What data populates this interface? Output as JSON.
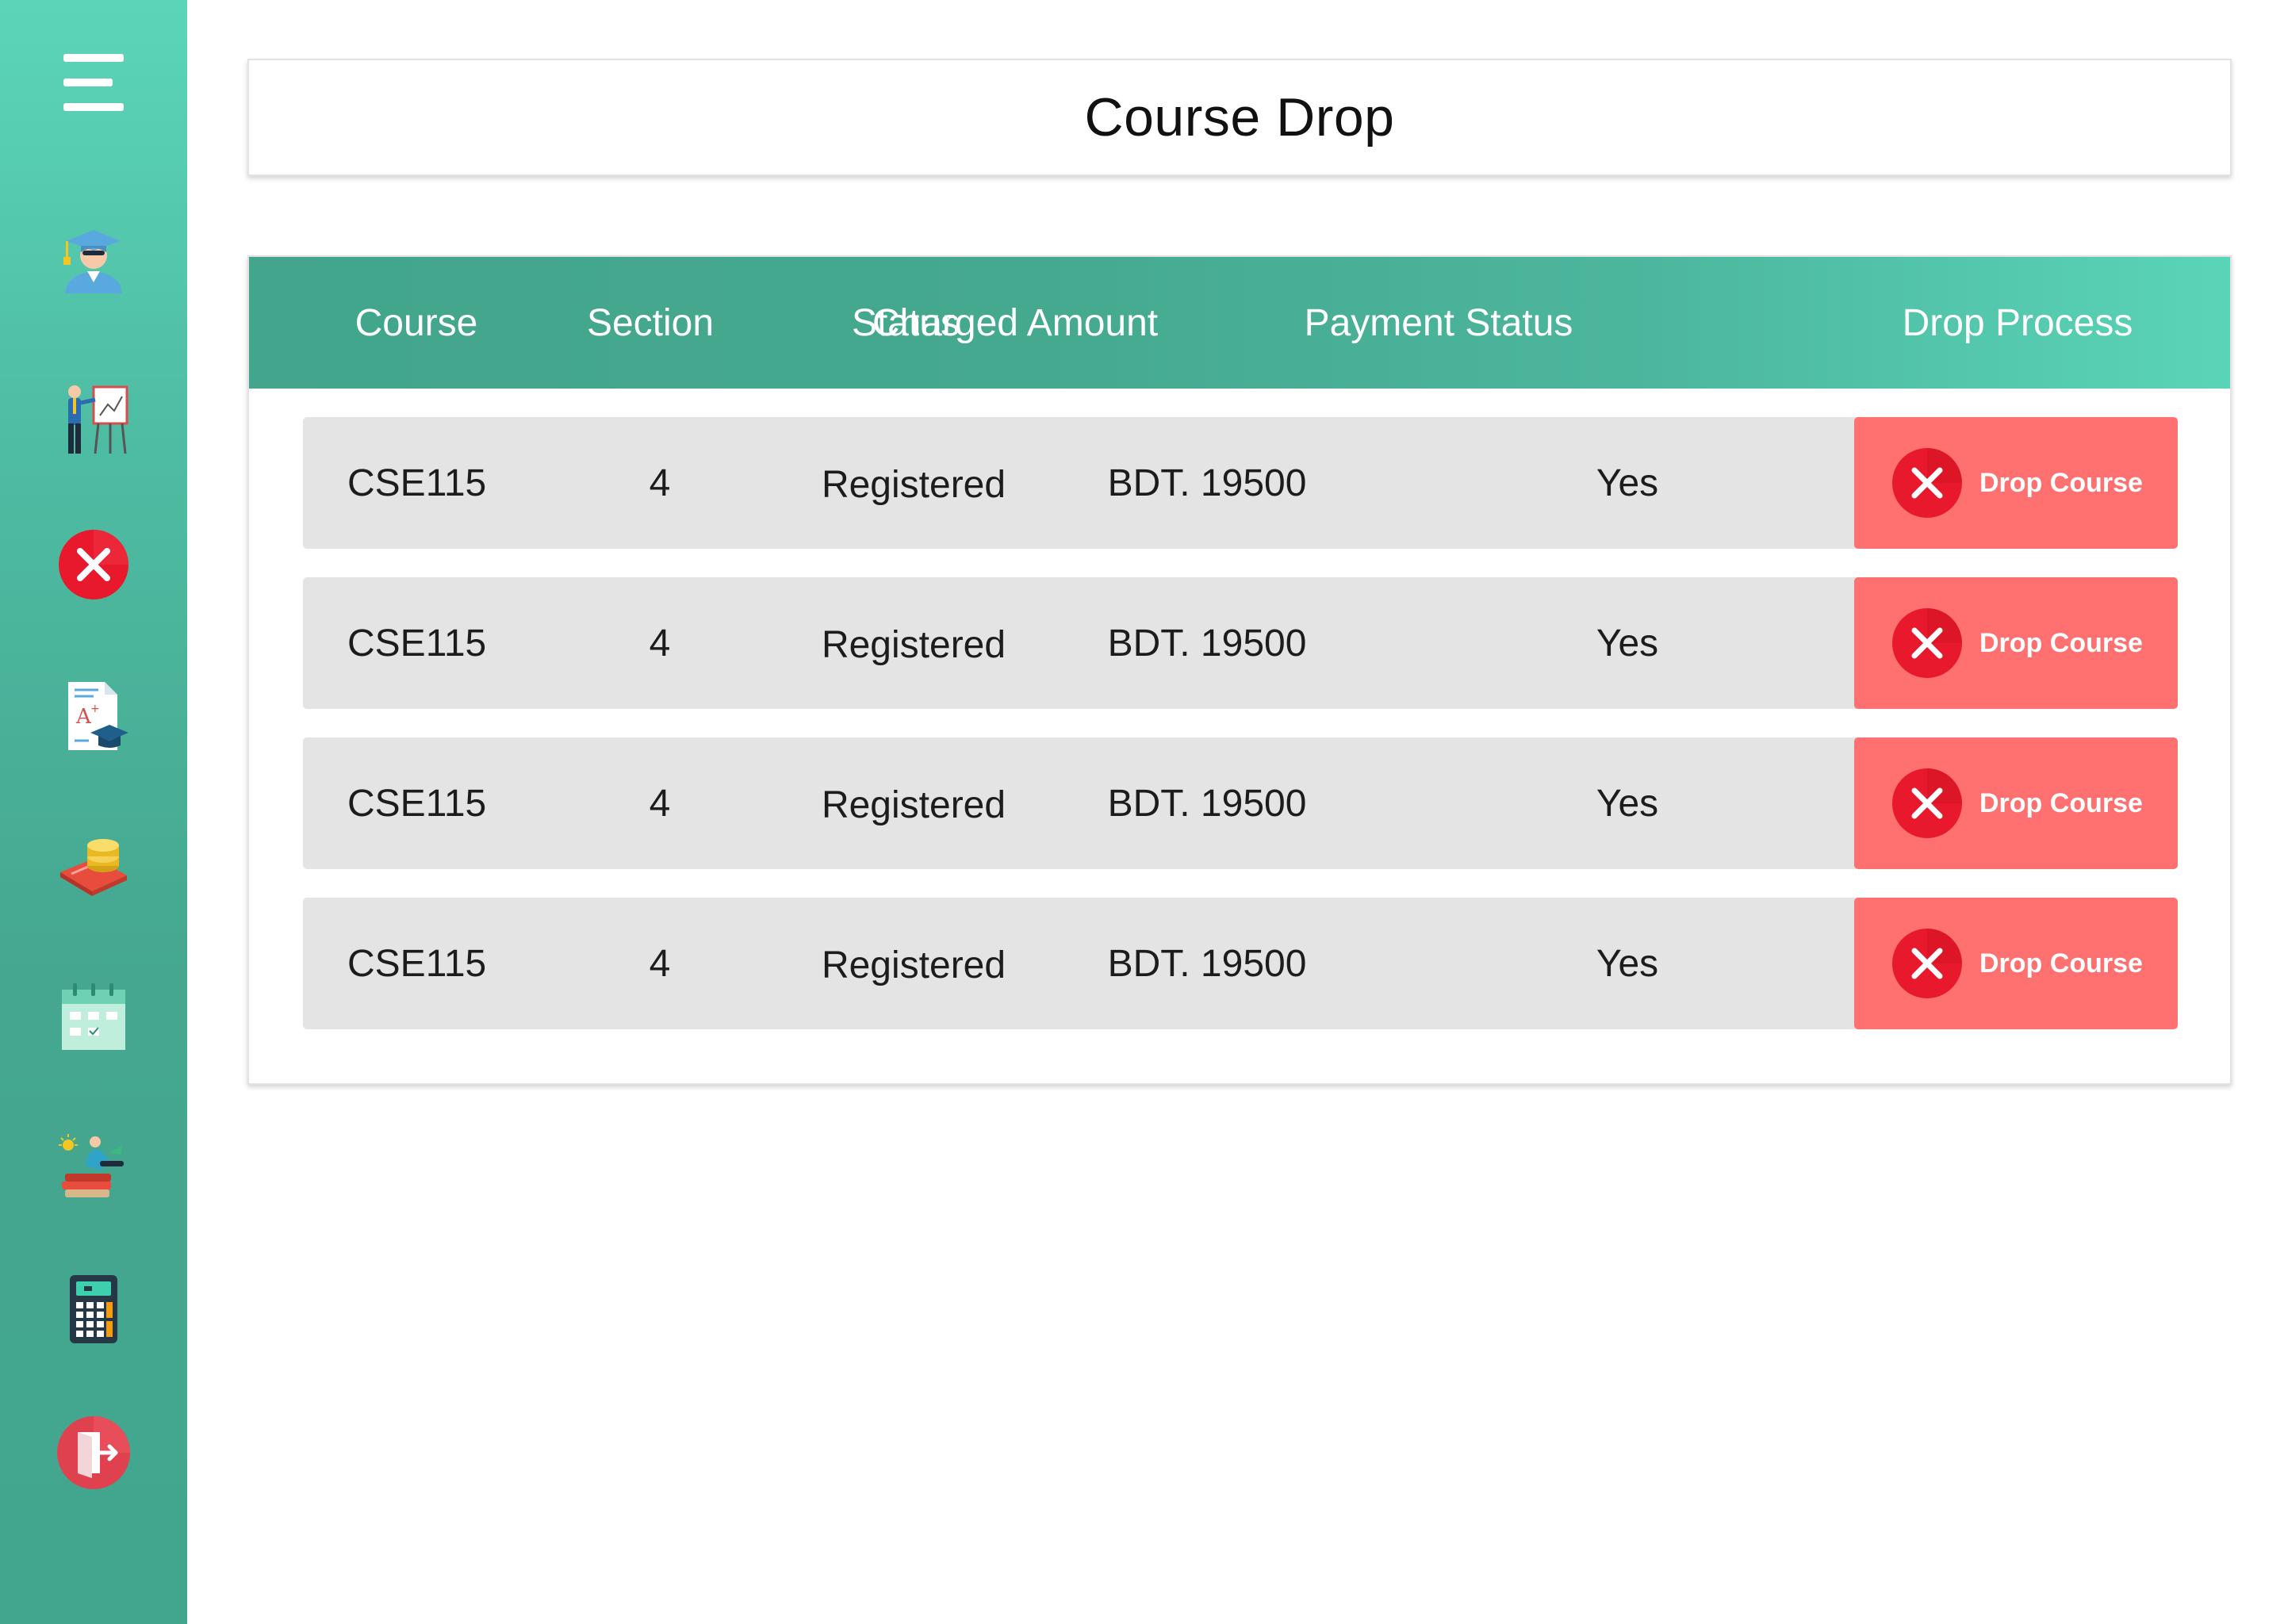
{
  "page": {
    "title": "Course Drop"
  },
  "sidebar": {
    "menu_icon": "hamburger-menu-icon",
    "items": [
      {
        "id": "student",
        "icon": "graduate-student-icon"
      },
      {
        "id": "teaching",
        "icon": "teacher-board-icon"
      },
      {
        "id": "course-drop",
        "icon": "red-cross-icon"
      },
      {
        "id": "grades",
        "icon": "grade-report-icon"
      },
      {
        "id": "payments",
        "icon": "payment-coins-icon"
      },
      {
        "id": "calendar",
        "icon": "calendar-icon"
      },
      {
        "id": "advising",
        "icon": "study-books-icon"
      },
      {
        "id": "calculator",
        "icon": "calculator-icon"
      },
      {
        "id": "logout",
        "icon": "logout-door-icon"
      }
    ]
  },
  "table": {
    "columns": [
      "Course",
      "Section",
      "Status",
      "Charged Amount",
      "Payment Status",
      "Drop Process"
    ],
    "rows": [
      {
        "course": "CSE115",
        "section": "4",
        "status": "Registered",
        "charged_amount": "BDT. 19500",
        "payment_status": "Yes",
        "action_label": "Drop Course"
      },
      {
        "course": "CSE115",
        "section": "4",
        "status": "Registered",
        "charged_amount": "BDT. 19500",
        "payment_status": "Yes",
        "action_label": "Drop Course"
      },
      {
        "course": "CSE115",
        "section": "4",
        "status": "Registered",
        "charged_amount": "BDT. 19500",
        "payment_status": "Yes",
        "action_label": "Drop Course"
      },
      {
        "course": "CSE115",
        "section": "4",
        "status": "Registered",
        "charged_amount": "BDT. 19500",
        "payment_status": "Yes",
        "action_label": "Drop Course"
      }
    ]
  },
  "colors": {
    "sidebar_top": "#5bd5b8",
    "sidebar_bottom": "#42a58d",
    "table_header_start": "#42a58c",
    "table_header_end": "#5ad4b7",
    "row_background": "#e4e4e4",
    "drop_button": "#ff7070",
    "drop_icon": "#e8192c"
  }
}
